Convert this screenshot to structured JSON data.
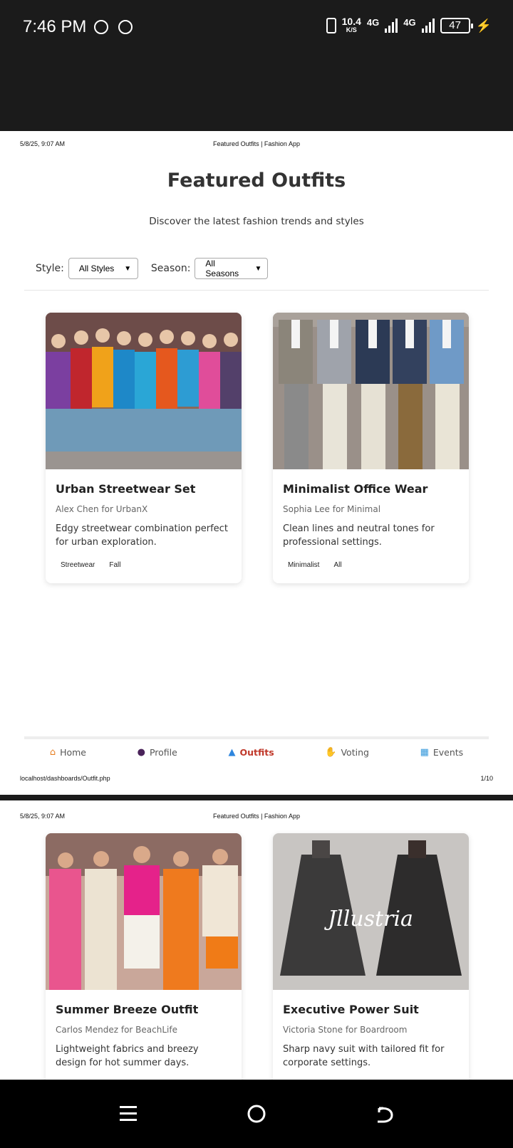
{
  "status_bar": {
    "time": "7:46 PM",
    "speed_value": "10.4",
    "speed_unit": "K/S",
    "net1": "4G",
    "net2": "4G",
    "battery": "47"
  },
  "print_header": {
    "datetime": "5/8/25, 9:07 AM",
    "page_title": "Featured Outfits | Fashion App"
  },
  "print_footer": {
    "url": "localhost/dashboards/Outfit.php",
    "page_number": "1/10"
  },
  "main": {
    "title": "Featured Outfits",
    "subtitle": "Discover the latest fashion trends and styles"
  },
  "filters": {
    "style_label": "Style:",
    "style_value": "All Styles",
    "season_label": "Season:",
    "season_value": "All Seasons"
  },
  "outfits": [
    {
      "name": "Urban Streetwear Set",
      "designer": "Alex Chen for UrbanX",
      "description": "Edgy streetwear combination perfect for urban exploration.",
      "tags": [
        "Streetwear",
        "Fall"
      ]
    },
    {
      "name": "Minimalist Office Wear",
      "designer": "Sophia Lee for Minimal",
      "description": "Clean lines and neutral tones for professional settings.",
      "tags": [
        "Minimalist",
        "All"
      ]
    },
    {
      "name": "Summer Breeze Outfit",
      "designer": "Carlos Mendez for BeachLife",
      "description": "Lightweight fabrics and breezy design for hot summer days.",
      "tags": []
    },
    {
      "name": "Executive Power Suit",
      "designer": "Victoria Stone for Boardroom",
      "description": "Sharp navy suit with tailored fit for corporate settings.",
      "tags": [],
      "image_watermark": "Jllustria"
    }
  ],
  "bottom_nav": {
    "items": [
      {
        "label": "Home",
        "icon": "house-icon"
      },
      {
        "label": "Profile",
        "icon": "person-icon"
      },
      {
        "label": "Outfits",
        "icon": "dress-icon"
      },
      {
        "label": "Voting",
        "icon": "hand-icon"
      },
      {
        "label": "Events",
        "icon": "calendar-icon"
      }
    ],
    "active": "Outfits"
  },
  "colors": {
    "accent": "#c0392b",
    "status_bar_bg": "#1b1b1b"
  }
}
